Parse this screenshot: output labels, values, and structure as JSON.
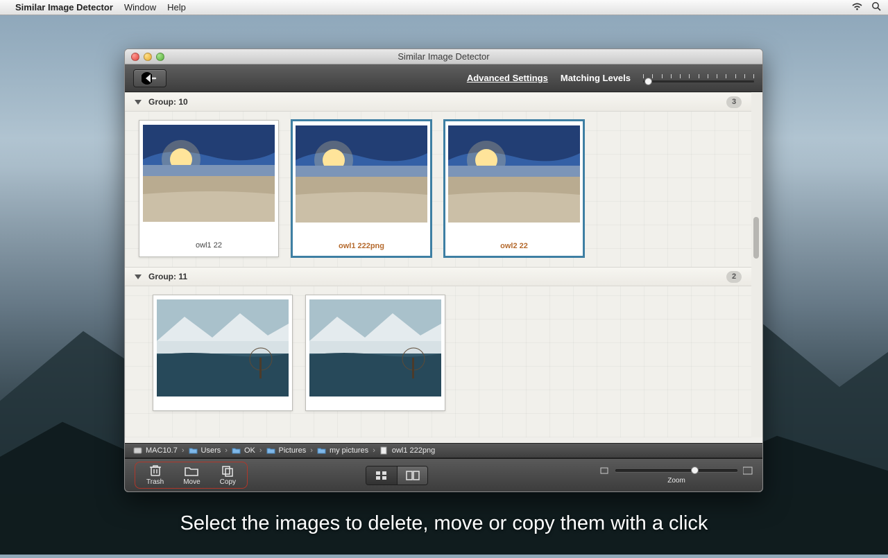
{
  "menubar": {
    "app_name": "Similar Image Detector",
    "items": [
      "Window",
      "Help"
    ]
  },
  "caption": "Select the images to delete, move or copy them with a click",
  "window": {
    "title": "Similar Image Detector"
  },
  "toolbar": {
    "advanced_link": "Advanced Settings",
    "matching_label": "Matching Levels"
  },
  "groups": [
    {
      "label": "Group: 10",
      "count": "3",
      "items": [
        {
          "name": "owl1 22",
          "selected": false
        },
        {
          "name": "owl1 222png",
          "selected": true
        },
        {
          "name": "owl2 22",
          "selected": true
        }
      ]
    },
    {
      "label": "Group: 11",
      "count": "2",
      "items": [
        {
          "name": "",
          "selected": false
        },
        {
          "name": "",
          "selected": false
        }
      ]
    }
  ],
  "path": {
    "segments": [
      "MAC10.7",
      "Users",
      "OK",
      "Pictures",
      "my pictures",
      "owl1 222png"
    ]
  },
  "footer": {
    "trash": "Trash",
    "move": "Move",
    "copy": "Copy",
    "zoom": "Zoom"
  }
}
